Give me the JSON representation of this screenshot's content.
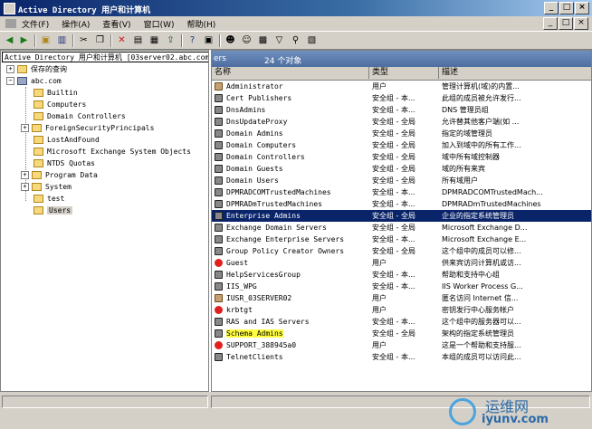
{
  "window": {
    "title": "Active Directory 用户和计算机",
    "controls": [
      "_",
      "□",
      "×"
    ]
  },
  "menu": {
    "items": [
      "文件(F)",
      "操作(A)",
      "查看(V)",
      "窗口(W)",
      "帮助(H)"
    ],
    "mdi_controls": [
      "_",
      "□",
      "×"
    ]
  },
  "tree": {
    "root_label": "Active Directory 用户和计算机 [03server02.abc.com]",
    "saved_queries": "保存的查询",
    "domain": "abc.com",
    "items": [
      {
        "label": "Builtin",
        "expandable": false
      },
      {
        "label": "Computers",
        "expandable": false
      },
      {
        "label": "Domain Controllers",
        "expandable": false
      },
      {
        "label": "ForeignSecurityPrincipals",
        "expandable": true
      },
      {
        "label": "LostAndFound",
        "expandable": false
      },
      {
        "label": "Microsoft Exchange System Objects",
        "expandable": false
      },
      {
        "label": "NTDS Quotas",
        "expandable": false
      },
      {
        "label": "Program Data",
        "expandable": true
      },
      {
        "label": "System",
        "expandable": true
      },
      {
        "label": "test",
        "expandable": false
      },
      {
        "label": "Users",
        "expandable": false,
        "selected": true
      }
    ]
  },
  "details": {
    "header_label": "ers",
    "count": "24 个对象",
    "columns": [
      "名称",
      "类型",
      "描述"
    ],
    "rows": [
      {
        "name": "Administrator",
        "type": "用户",
        "desc": "管理计算机(域)的内置...",
        "icon": "user-icon"
      },
      {
        "name": "Cert Publishers",
        "type": "安全组 - 本...",
        "desc": "此组的成员被允许发行...",
        "icon": "group-icon"
      },
      {
        "name": "DnsAdmins",
        "type": "安全组 - 本...",
        "desc": "DNS 管理员组",
        "icon": "group-icon"
      },
      {
        "name": "DnsUpdateProxy",
        "type": "安全组 - 全局",
        "desc": "允许替其他客户端(如 ...",
        "icon": "group-icon"
      },
      {
        "name": "Domain Admins",
        "type": "安全组 - 全局",
        "desc": "指定的域管理员",
        "icon": "group-icon"
      },
      {
        "name": "Domain Computers",
        "type": "安全组 - 全局",
        "desc": "加入到域中的所有工作...",
        "icon": "group-icon"
      },
      {
        "name": "Domain Controllers",
        "type": "安全组 - 全局",
        "desc": "域中所有域控制器",
        "icon": "group-icon"
      },
      {
        "name": "Domain Guests",
        "type": "安全组 - 全局",
        "desc": "域的所有来宾",
        "icon": "group-icon"
      },
      {
        "name": "Domain Users",
        "type": "安全组 - 全局",
        "desc": "所有域用户",
        "icon": "group-icon"
      },
      {
        "name": "DPMRADCOMTrustedMachines",
        "type": "安全组 - 本...",
        "desc": "DPMRADCOMTrustedMach...",
        "icon": "group-icon"
      },
      {
        "name": "DPMRADmTrustedMachines",
        "type": "安全组 - 本...",
        "desc": "DPMRADmTrustedMachines",
        "icon": "group-icon"
      },
      {
        "name": "Enterprise Admins",
        "type": "安全组 - 全局",
        "desc": "企业的指定系统管理员",
        "icon": "group-icon",
        "selected": true
      },
      {
        "name": "Exchange Domain Servers",
        "type": "安全组 - 全局",
        "desc": "Microsoft Exchange D...",
        "icon": "group-icon"
      },
      {
        "name": "Exchange Enterprise Servers",
        "type": "安全组 - 本...",
        "desc": "Microsoft Exchange E...",
        "icon": "group-icon"
      },
      {
        "name": "Group Policy Creator Owners",
        "type": "安全组 - 全局",
        "desc": "这个组中的成员可以修...",
        "icon": "group-icon"
      },
      {
        "name": "Guest",
        "type": "用户",
        "desc": "供来宾访问计算机或访...",
        "icon": "disabled-user-icon"
      },
      {
        "name": "HelpServicesGroup",
        "type": "安全组 - 本...",
        "desc": "帮助和支持中心组",
        "icon": "group-icon"
      },
      {
        "name": "IIS_WPG",
        "type": "安全组 - 本...",
        "desc": "IIS Worker Process G...",
        "icon": "group-icon"
      },
      {
        "name": "IUSR_03SERVER02",
        "type": "用户",
        "desc": "匿名访问 Internet 信...",
        "icon": "user-icon"
      },
      {
        "name": "krbtgt",
        "type": "用户",
        "desc": "密钥发行中心服务帐户",
        "icon": "disabled-user-icon"
      },
      {
        "name": "RAS and IAS Servers",
        "type": "安全组 - 本...",
        "desc": "这个组中的服务器可以...",
        "icon": "group-icon"
      },
      {
        "name": "Schema Admins",
        "type": "安全组 - 全局",
        "desc": "架构的指定系统管理员",
        "icon": "group-icon",
        "highlight": true
      },
      {
        "name": "SUPPORT_388945a0",
        "type": "用户",
        "desc": "这是一个帮助和支持服...",
        "icon": "disabled-user-icon"
      },
      {
        "name": "TelnetClients",
        "type": "安全组 - 本...",
        "desc": "本组的成员可以访问此...",
        "icon": "group-icon"
      }
    ]
  },
  "watermark": {
    "cn": "运维网",
    "url": "iyunv.com"
  },
  "colors": {
    "selection": "#0a246a",
    "title_gradient_start": "#0a246a",
    "highlight": "#ffff40",
    "chrome": "#d4d0c8"
  }
}
